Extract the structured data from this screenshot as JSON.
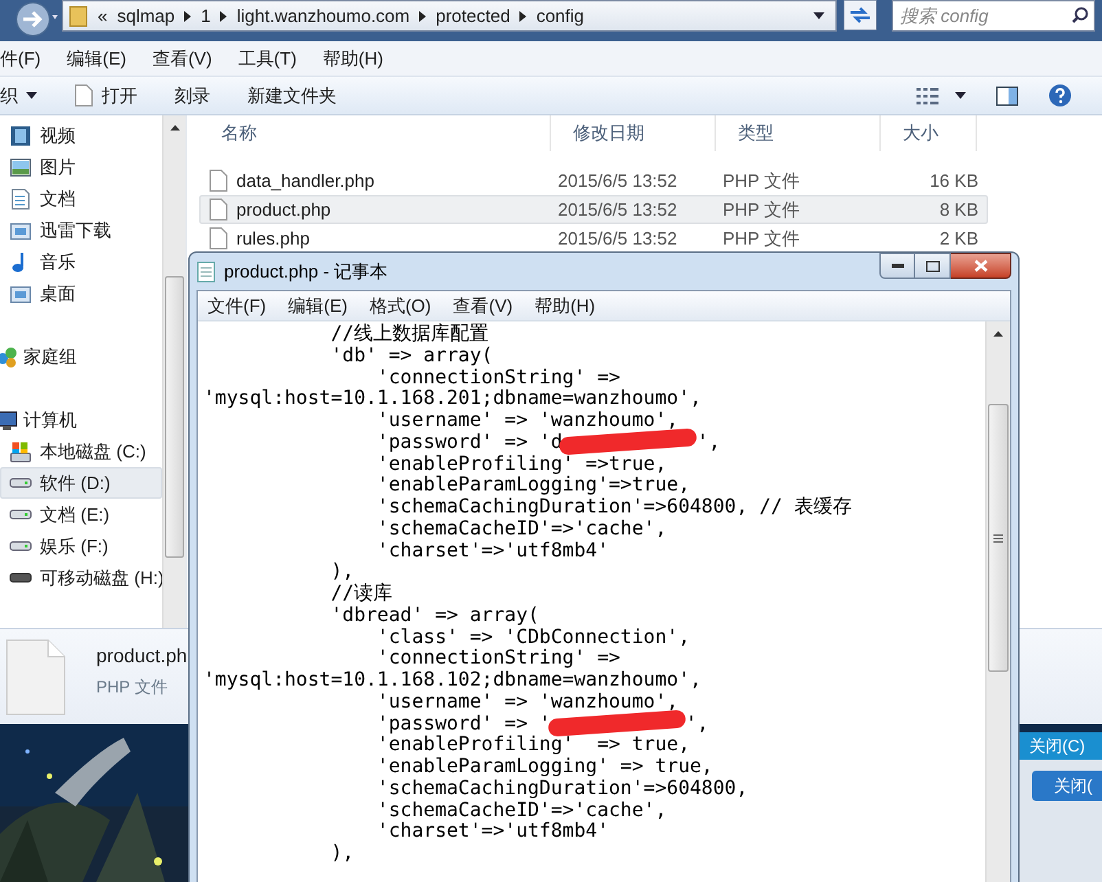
{
  "explorer": {
    "address": {
      "overflow": "«",
      "crumbs": [
        "sqlmap",
        "1",
        "light.wanzhoumo.com",
        "protected",
        "config"
      ]
    },
    "search": {
      "placeholder": "搜索 config"
    },
    "menu": [
      "件(F)",
      "编辑(E)",
      "查看(V)",
      "工具(T)",
      "帮助(H)"
    ],
    "toolbar": [
      {
        "label": "织",
        "kind": "dropdown"
      },
      {
        "label": "打开",
        "kind": "open"
      },
      {
        "label": "刻录",
        "kind": "plain"
      },
      {
        "label": "新建文件夹",
        "kind": "plain"
      }
    ],
    "nav": [
      {
        "items": [
          {
            "label": "视频",
            "kind": "video",
            "selected": false
          },
          {
            "label": "图片",
            "kind": "picture",
            "selected": false
          },
          {
            "label": "文档",
            "kind": "document",
            "selected": false
          },
          {
            "label": "迅雷下载",
            "kind": "folder",
            "selected": false
          },
          {
            "label": "音乐",
            "kind": "music",
            "selected": false
          },
          {
            "label": "桌面",
            "kind": "folder",
            "selected": false
          }
        ]
      },
      {
        "header": {
          "label": "家庭组",
          "kind": "homegroup"
        }
      },
      {
        "header": {
          "label": "计算机",
          "kind": "computer"
        },
        "items": [
          {
            "label": "本地磁盘 (C:)",
            "kind": "system-drive",
            "selected": false
          },
          {
            "label": "软件 (D:)",
            "kind": "drive",
            "selected": true
          },
          {
            "label": "文档 (E:)",
            "kind": "drive",
            "selected": false
          },
          {
            "label": "娱乐 (F:)",
            "kind": "drive",
            "selected": false
          },
          {
            "label": "可移动磁盘 (H:)",
            "kind": "removable",
            "selected": false
          }
        ]
      }
    ],
    "columns": [
      "名称",
      "修改日期",
      "类型",
      "大小"
    ],
    "files": [
      {
        "name": "data_handler.php",
        "modified": "2015/6/5 13:52",
        "type": "PHP 文件",
        "size": "16 KB",
        "selected": false
      },
      {
        "name": "product.php",
        "modified": "2015/6/5 13:52",
        "type": "PHP 文件",
        "size": "8 KB",
        "selected": true
      },
      {
        "name": "rules.php",
        "modified": "2015/6/5 13:52",
        "type": "PHP 文件",
        "size": "2 KB",
        "selected": false
      }
    ],
    "details": {
      "name": "product.ph",
      "type": "PHP 文件"
    }
  },
  "notepad": {
    "title": "product.php - 记事本",
    "menu": [
      "文件(F)",
      "编辑(E)",
      "格式(O)",
      "查看(V)",
      "帮助(H)"
    ],
    "lines": [
      {
        "text": "           //线上数据库配置"
      },
      {
        "text": "           'db' => array("
      },
      {
        "text": "               'connectionString' =>"
      },
      {
        "text": "'mysql:host=10.1.168.201;dbname=wanzhoumo',"
      },
      {
        "text": "               'username' => 'wanzhoumo',"
      },
      {
        "text": "               'password' => 'd",
        "redacted": true,
        "tail": "',"
      },
      {
        "text": "               'enableProfiling' =>true,"
      },
      {
        "text": "               'enableParamLogging'=>true,"
      },
      {
        "text": "               'schemaCachingDuration'=>604800, // 表缓存"
      },
      {
        "text": "               'schemaCacheID'=>'cache',"
      },
      {
        "text": "               'charset'=>'utf8mb4'"
      },
      {
        "text": "           ),"
      },
      {
        "text": "           //读库"
      },
      {
        "text": "           'dbread' => array("
      },
      {
        "text": "               'class' => 'CDbConnection',"
      },
      {
        "text": "               'connectionString' =>"
      },
      {
        "text": "'mysql:host=10.1.168.102;dbname=wanzhoumo',"
      },
      {
        "text": "               'username' => 'wanzhoumo',"
      },
      {
        "text": "               'password' => '",
        "redacted": true,
        "tail": "',"
      },
      {
        "text": "               'enableProfiling'  => true,"
      },
      {
        "text": "               'enableParamLogging' => true,"
      },
      {
        "text": "               'schemaCachingDuration'=>604800,"
      },
      {
        "text": "               'schemaCacheID'=>'cache',"
      },
      {
        "text": "               'charset'=>'utf8mb4'"
      },
      {
        "text": "           ),"
      }
    ]
  },
  "dialog": {
    "menu_item": "关闭(C)",
    "button": "关闭("
  }
}
